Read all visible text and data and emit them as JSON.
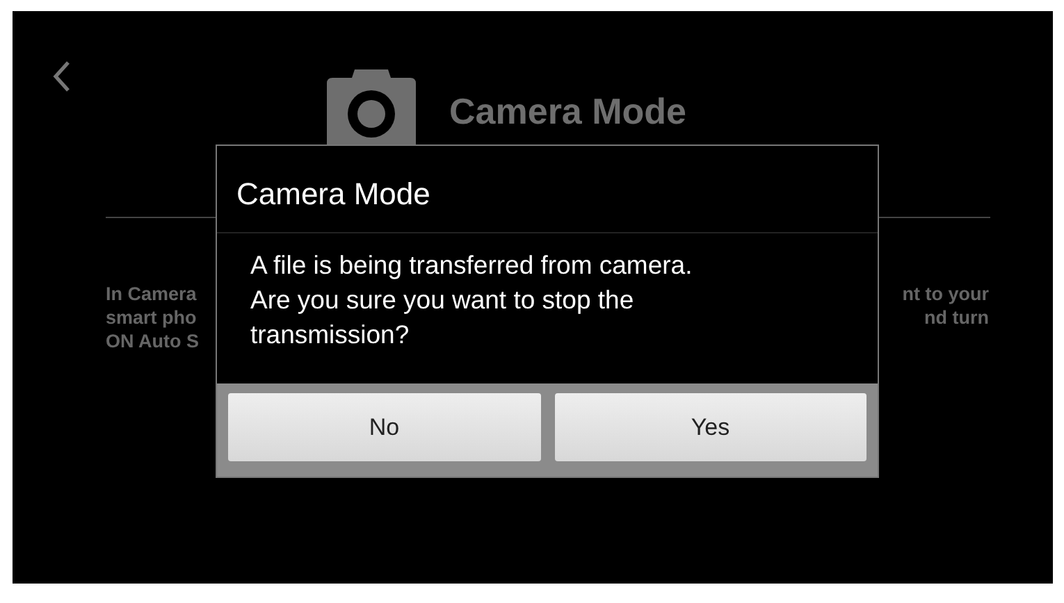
{
  "header": {
    "title": "Camera Mode"
  },
  "background_text": {
    "left_lines": [
      "In Camera",
      "smart pho",
      "ON Auto S"
    ],
    "right_lines": [
      "nt to your",
      "nd turn"
    ]
  },
  "dialog": {
    "title": "Camera Mode",
    "message": [
      "A file is being transferred from camera.",
      "Are you sure you want to stop the",
      "transmission?"
    ],
    "buttons": [
      "No",
      "Yes"
    ]
  }
}
